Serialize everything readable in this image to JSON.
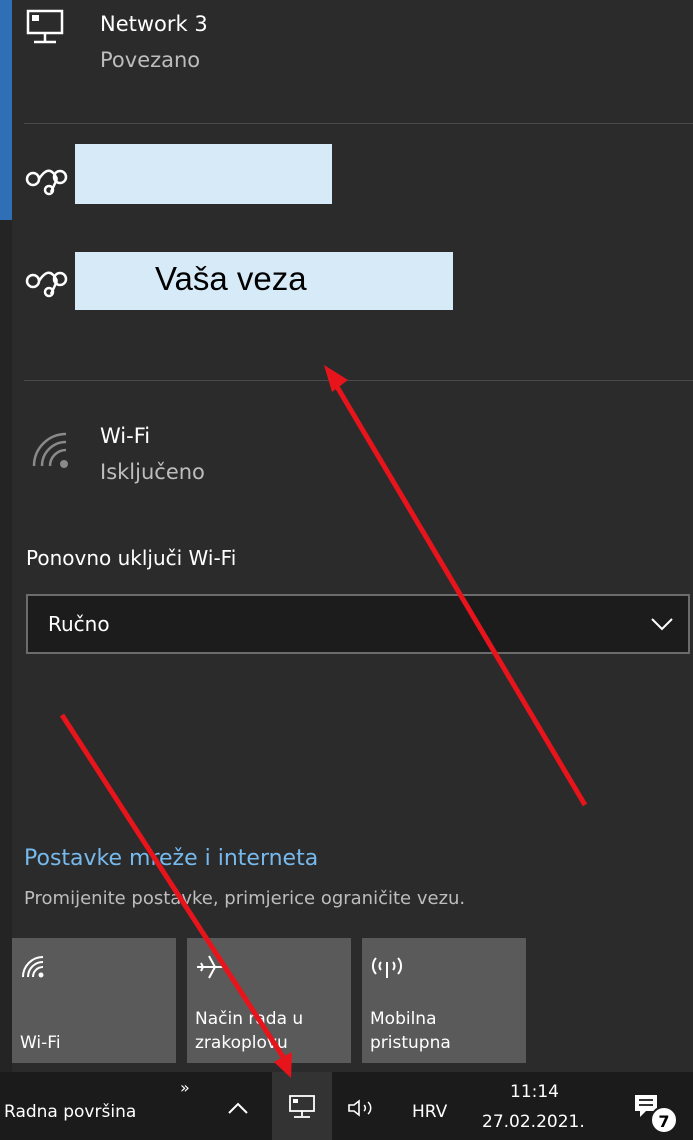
{
  "network3": {
    "name": "Network 3",
    "status": "Povezano"
  },
  "redacted_connection": {
    "label": "Vaša veza"
  },
  "wifi": {
    "name": "Wi-Fi",
    "status": "Isključeno"
  },
  "reenable": {
    "label": "Ponovno uključi Wi-Fi",
    "selected": "Ručno"
  },
  "settings": {
    "link": "Postavke mreže i interneta",
    "description": "Promijenite postavke, primjerice ograničite vezu."
  },
  "tiles": [
    {
      "icon": "wifi-icon",
      "label": "Wi-Fi"
    },
    {
      "icon": "airplane-icon",
      "label": "Način rada u zrakoplovu"
    },
    {
      "icon": "hotspot-icon",
      "label": "Mobilna pristupna"
    }
  ],
  "taskbar": {
    "desktop_label": "Radna površina",
    "language": "HRV",
    "time": "11:14",
    "date": "27.02.2021.",
    "notification_count": "7"
  },
  "colors": {
    "accent_link": "#76b9ed",
    "annotation_arrow": "#e8141c",
    "redaction": "#d6eaf8"
  }
}
